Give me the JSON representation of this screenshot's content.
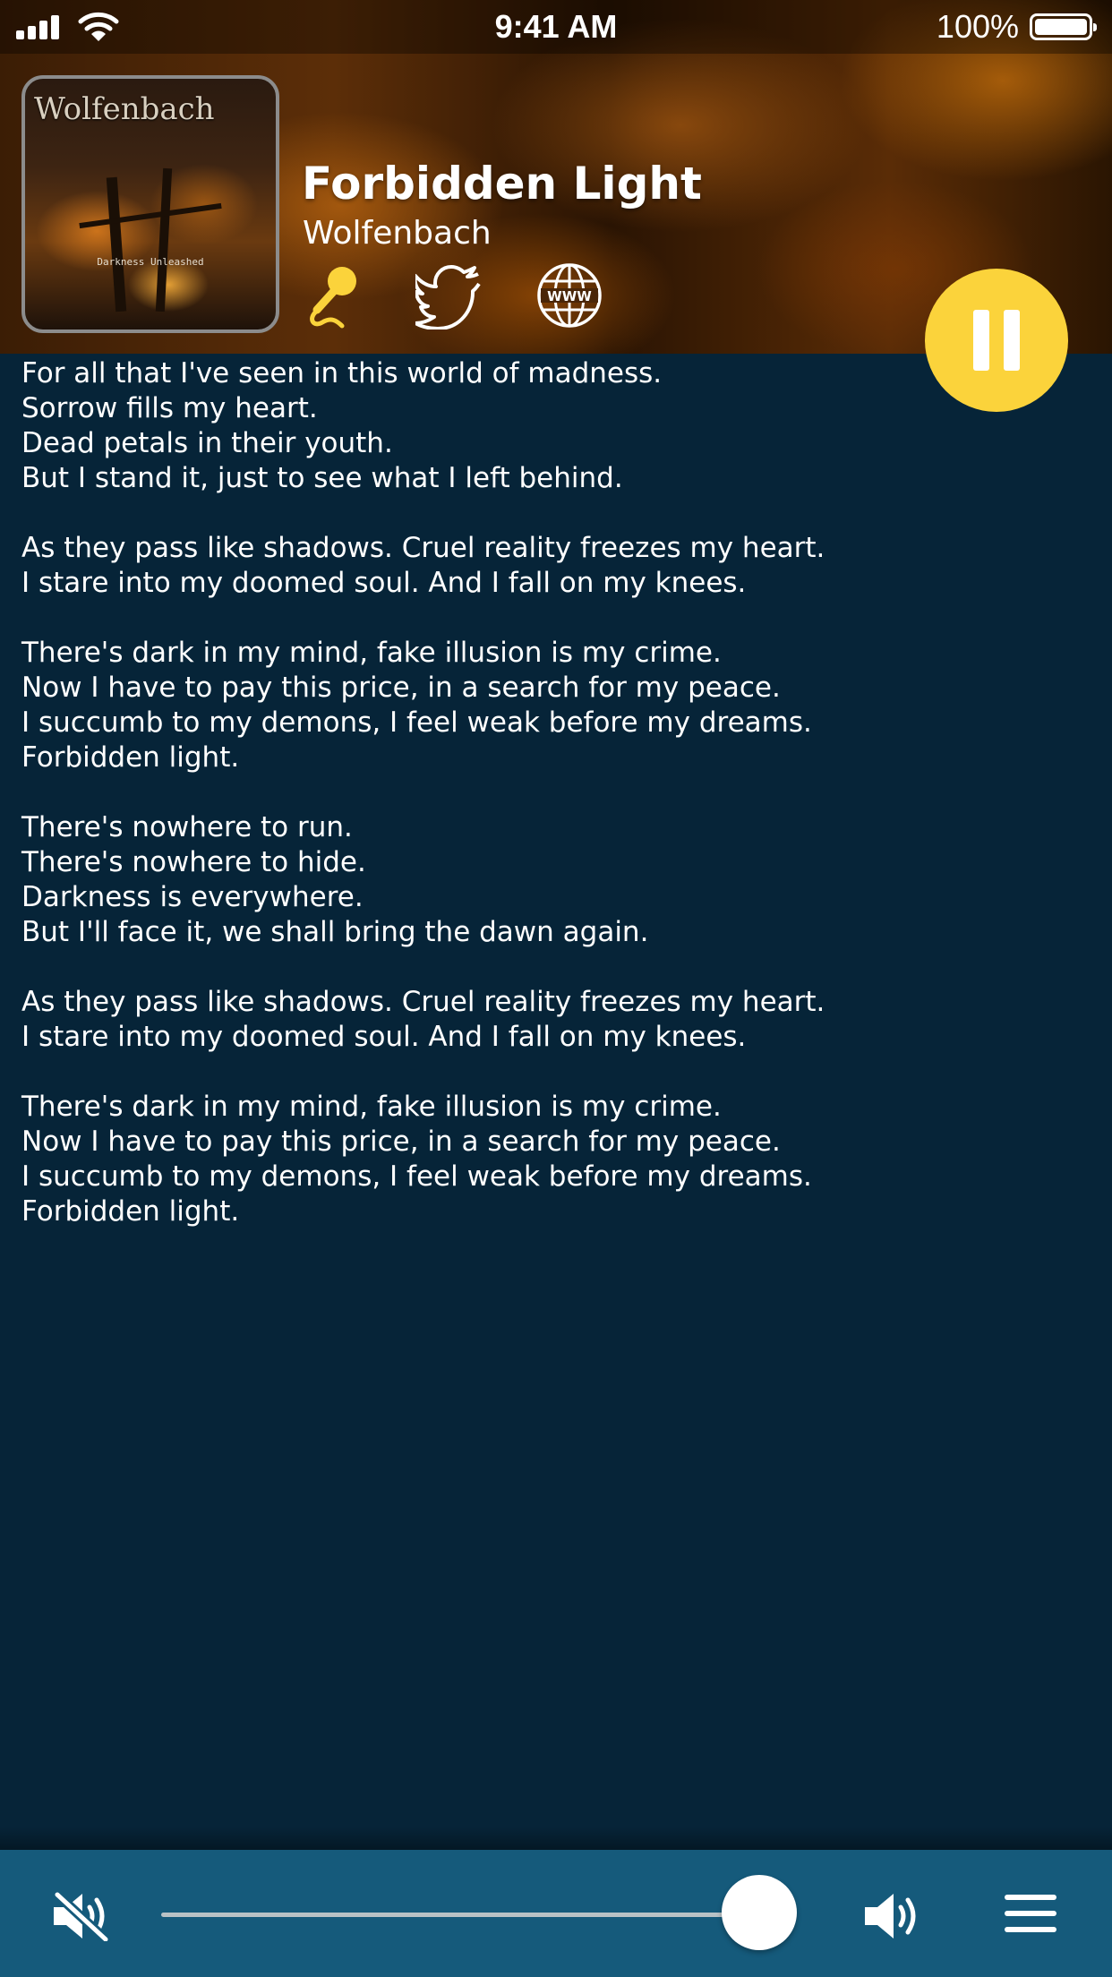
{
  "status_bar": {
    "time": "9:41 AM",
    "battery": "100%"
  },
  "now_playing": {
    "album_art": {
      "band_text": "Wolfenbach",
      "album_text": "Darkness Unleashed"
    },
    "title": "Forbidden Light",
    "artist": "Wolfenbach",
    "actions": [
      "lyrics-microphone-icon",
      "twitter-bird-icon",
      "website-globe-icon"
    ],
    "play_state": "playing",
    "accent_color": "#fbd33b"
  },
  "lyrics": {
    "stanzas": [
      [
        "For all that I've seen in this world of madness.",
        "Sorrow fills my heart.",
        "Dead petals in their youth.",
        "But I stand it, just to see what I left behind."
      ],
      [
        "As they pass like shadows. Cruel reality freezes my heart.",
        "I stare into my doomed soul. And I fall on my knees."
      ],
      [
        "There's dark in my mind, fake illusion is my crime.",
        "Now I have to pay this price, in a search for my peace.",
        "I succumb to my demons, I feel weak before my dreams.",
        "Forbidden light."
      ],
      [
        "There's nowhere to run.",
        "There's nowhere to hide.",
        "Darkness is everywhere.",
        "But I'll face it, we shall bring the dawn again."
      ],
      [
        "As they pass like shadows. Cruel reality freezes my heart.",
        "I stare into my doomed soul. And I fall on my knees."
      ],
      [
        "There's dark in my mind, fake illusion is my crime.",
        "Now I have to pay this price, in a search for my peace.",
        "I succumb to my demons, I feel weak before my dreams.",
        "Forbidden light."
      ]
    ]
  },
  "controls": {
    "volume_level": 0.93,
    "bar_color": "#155a7b",
    "icons": [
      "mute-speaker-icon",
      "volume-speaker-icon",
      "menu-icon"
    ]
  }
}
